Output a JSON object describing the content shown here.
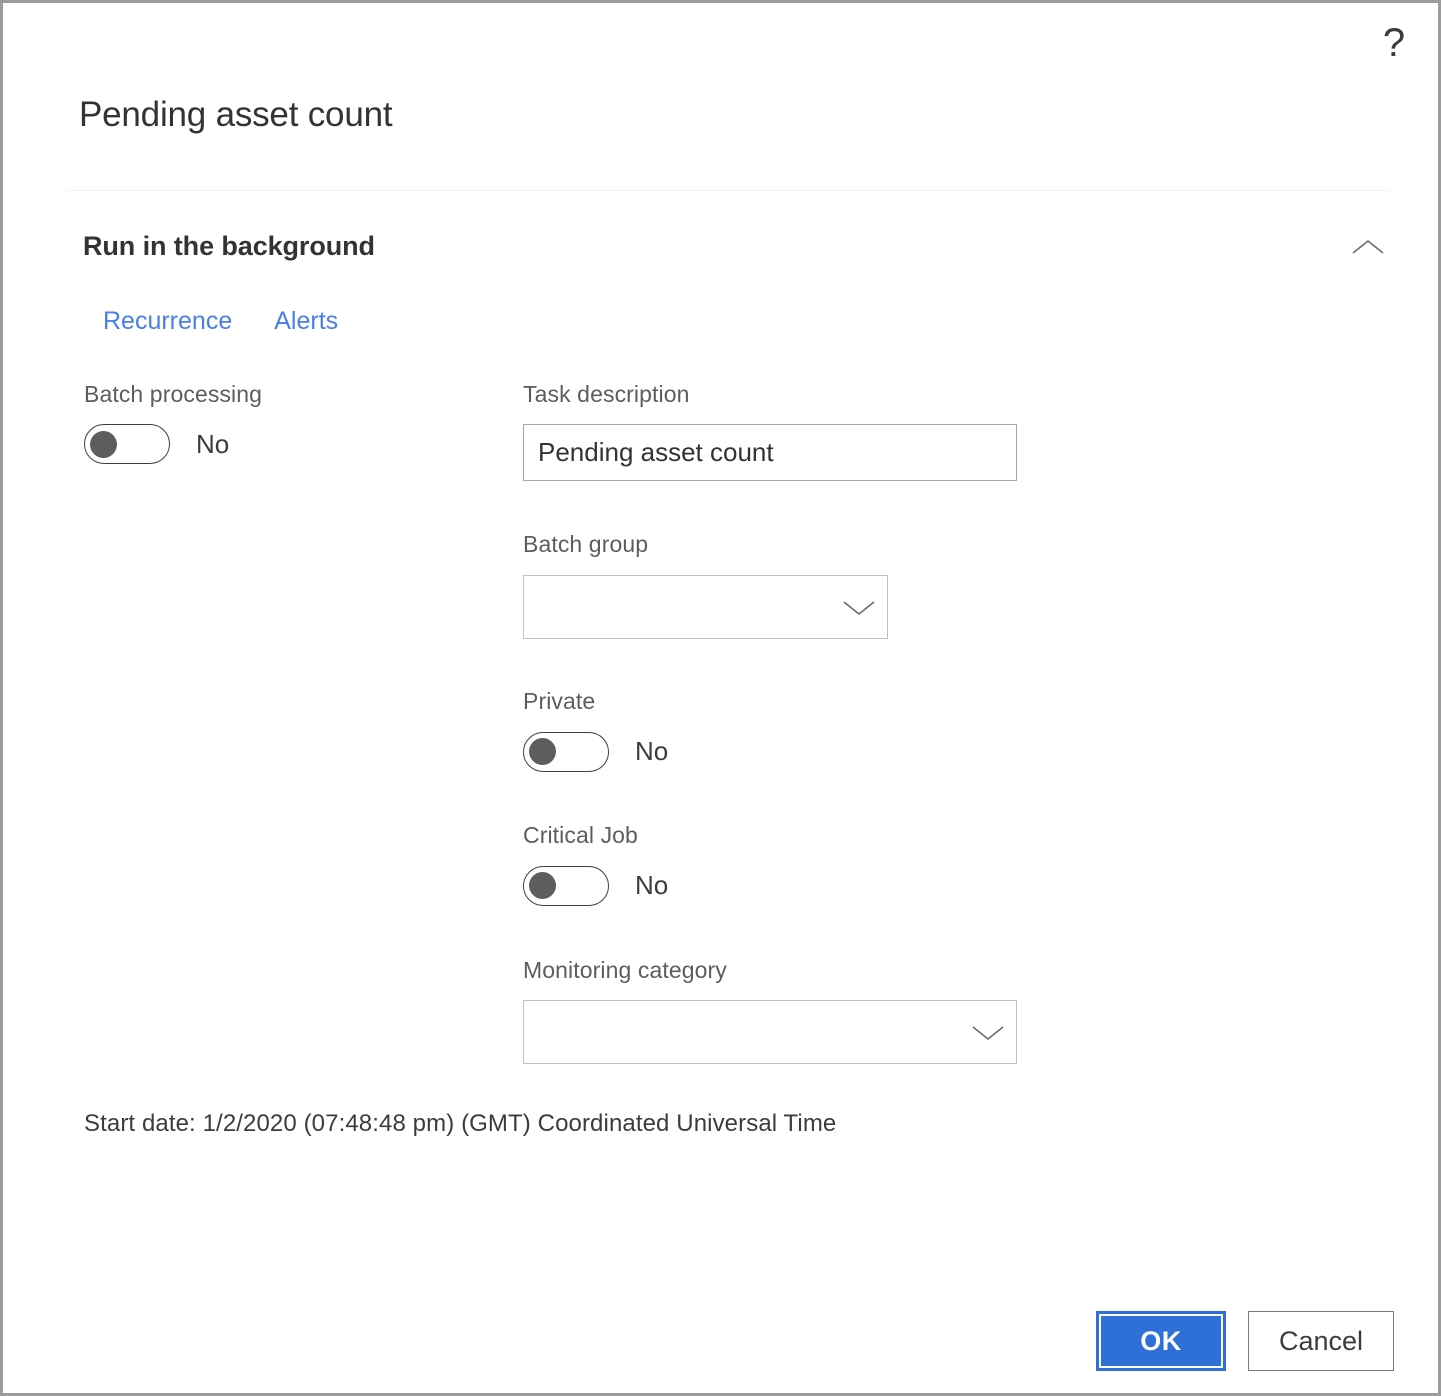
{
  "dialog": {
    "title": "Pending asset count",
    "help_icon_label": "?"
  },
  "section": {
    "title": "Run in the background",
    "collapse_icon": "chevron-up"
  },
  "tabs": [
    {
      "label": "Recurrence"
    },
    {
      "label": "Alerts"
    }
  ],
  "fields": {
    "batch_processing": {
      "label": "Batch processing",
      "value": "No",
      "state": "off"
    },
    "task_description": {
      "label": "Task description",
      "value": "Pending asset count",
      "placeholder": ""
    },
    "batch_group": {
      "label": "Batch group",
      "value": "",
      "arrow_icon": "chevron-down"
    },
    "private": {
      "label": "Private",
      "value": "No",
      "state": "off"
    },
    "critical_job": {
      "label": "Critical Job",
      "value": "No",
      "state": "off"
    },
    "monitoring_category": {
      "label": "Monitoring category",
      "value": "",
      "arrow_icon": "chevron-down"
    }
  },
  "start_date_text": "Start date: 1/2/2020 (07:48:48 pm) (GMT) Coordinated Universal Time",
  "footer": {
    "ok_label": "OK",
    "cancel_label": "Cancel"
  },
  "colors": {
    "link_blue": "#4a7ee8",
    "primary_button": "#2f6fd8",
    "dialog_border": "#9b9b9b",
    "label_gray": "#5d5d5d",
    "text_dark": "#333333"
  }
}
